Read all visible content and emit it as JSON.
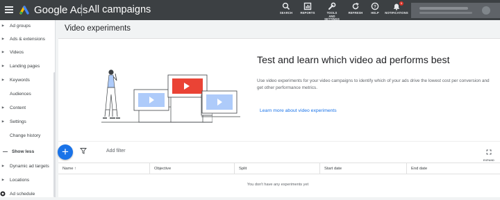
{
  "topbar": {
    "brand": "Google Ads",
    "breadcrumb": "All campaigns",
    "tools": [
      {
        "label": "SEARCH",
        "icon": "search-icon"
      },
      {
        "label": "REPORTS",
        "icon": "reports-icon"
      },
      {
        "label": "TOOLS AND SETTINGS",
        "icon": "wrench-icon"
      },
      {
        "label": "REFRESH",
        "icon": "refresh-icon"
      },
      {
        "label": "HELP",
        "icon": "help-icon"
      },
      {
        "label": "NOTIFICATIONS",
        "icon": "bell-icon",
        "badge": "1"
      }
    ]
  },
  "sidebar": {
    "items": [
      {
        "label": "Ad groups",
        "arrow": true
      },
      {
        "label": "Ads & extensions",
        "arrow": true
      },
      {
        "label": "Videos",
        "arrow": true
      },
      {
        "label": "Landing pages",
        "arrow": true
      },
      {
        "label": "Keywords",
        "arrow": true
      },
      {
        "label": "Audiences",
        "arrow": false
      },
      {
        "label": "Content",
        "arrow": true
      },
      {
        "label": "Settings",
        "arrow": true
      },
      {
        "label": "Change history",
        "arrow": false
      },
      {
        "label": "Show less",
        "arrow": false
      },
      {
        "label": "Dynamic ad targets",
        "arrow": true
      },
      {
        "label": "Locations",
        "arrow": true
      },
      {
        "label": "Ad schedule",
        "arrow": true
      }
    ]
  },
  "main": {
    "page_title": "Video experiments",
    "hero": {
      "title": "Test and learn which video ad performs best",
      "description": "Use video experiments for your video campaigns to identify which of your ads drive the lowest cost per conversion and get other performance metrics.",
      "link": "Learn more about video experiments"
    },
    "toolbar": {
      "fab": "+",
      "add_filter": "Add filter",
      "expand": "EXPAND"
    },
    "table": {
      "columns": [
        "Name",
        "Objective",
        "Split",
        "Start date",
        "End date"
      ],
      "sort_indicator": "↑",
      "empty": "You don't have any experiments yet"
    }
  },
  "colors": {
    "topbar": "#3c4043",
    "accent": "#1a73e8",
    "video_red": "#ea4335",
    "video_blue": "#aecbfa"
  }
}
